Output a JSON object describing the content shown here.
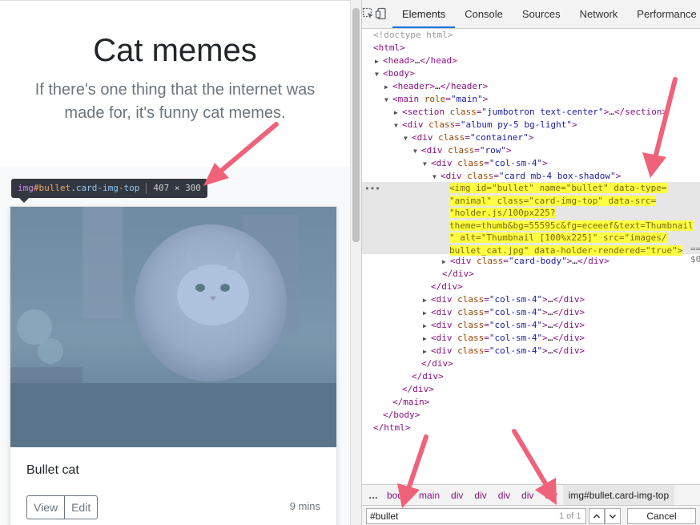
{
  "page": {
    "title": "Cat memes",
    "lead": "If there's one thing that the internet was made for, it's funny cat memes.",
    "tooltip": {
      "tag": "img",
      "id": "#bullet",
      "cls": ".card-img-top",
      "dims": "407 × 300"
    },
    "card": {
      "title": "Bullet cat",
      "view": "View",
      "edit": "Edit",
      "time": "9 mins"
    }
  },
  "devtools": {
    "tabs": [
      "Elements",
      "Console",
      "Sources",
      "Network",
      "Performance"
    ],
    "active_tab": "Elements",
    "breadcrumbs": [
      "…",
      "body",
      "main",
      "div",
      "div",
      "div",
      "div",
      "div"
    ],
    "breadcrumb_active": "img#bullet.card-img-top",
    "search": {
      "value": "#bullet",
      "count": "1 of 1",
      "cancel": "Cancel"
    },
    "selected": {
      "lines": [
        "<img id=\"bullet\" name=\"bullet\" data-type=",
        "\"animal\" class=\"card-img-top\" data-src=",
        "\"holder.js/100px225?",
        "theme=thumb&bg=55595c&fg=eceeef&text=Thumbnail",
        "\" alt=\"Thumbnail [100%x225]\" src=\"images/",
        "bullet_cat.jpg\" data-holder-rendered=\"true\">"
      ],
      "suffix": "== $0"
    }
  },
  "colors": {
    "arrow": "#f0627a",
    "highlight": "#ffff44",
    "accent": "#1a73e8"
  }
}
